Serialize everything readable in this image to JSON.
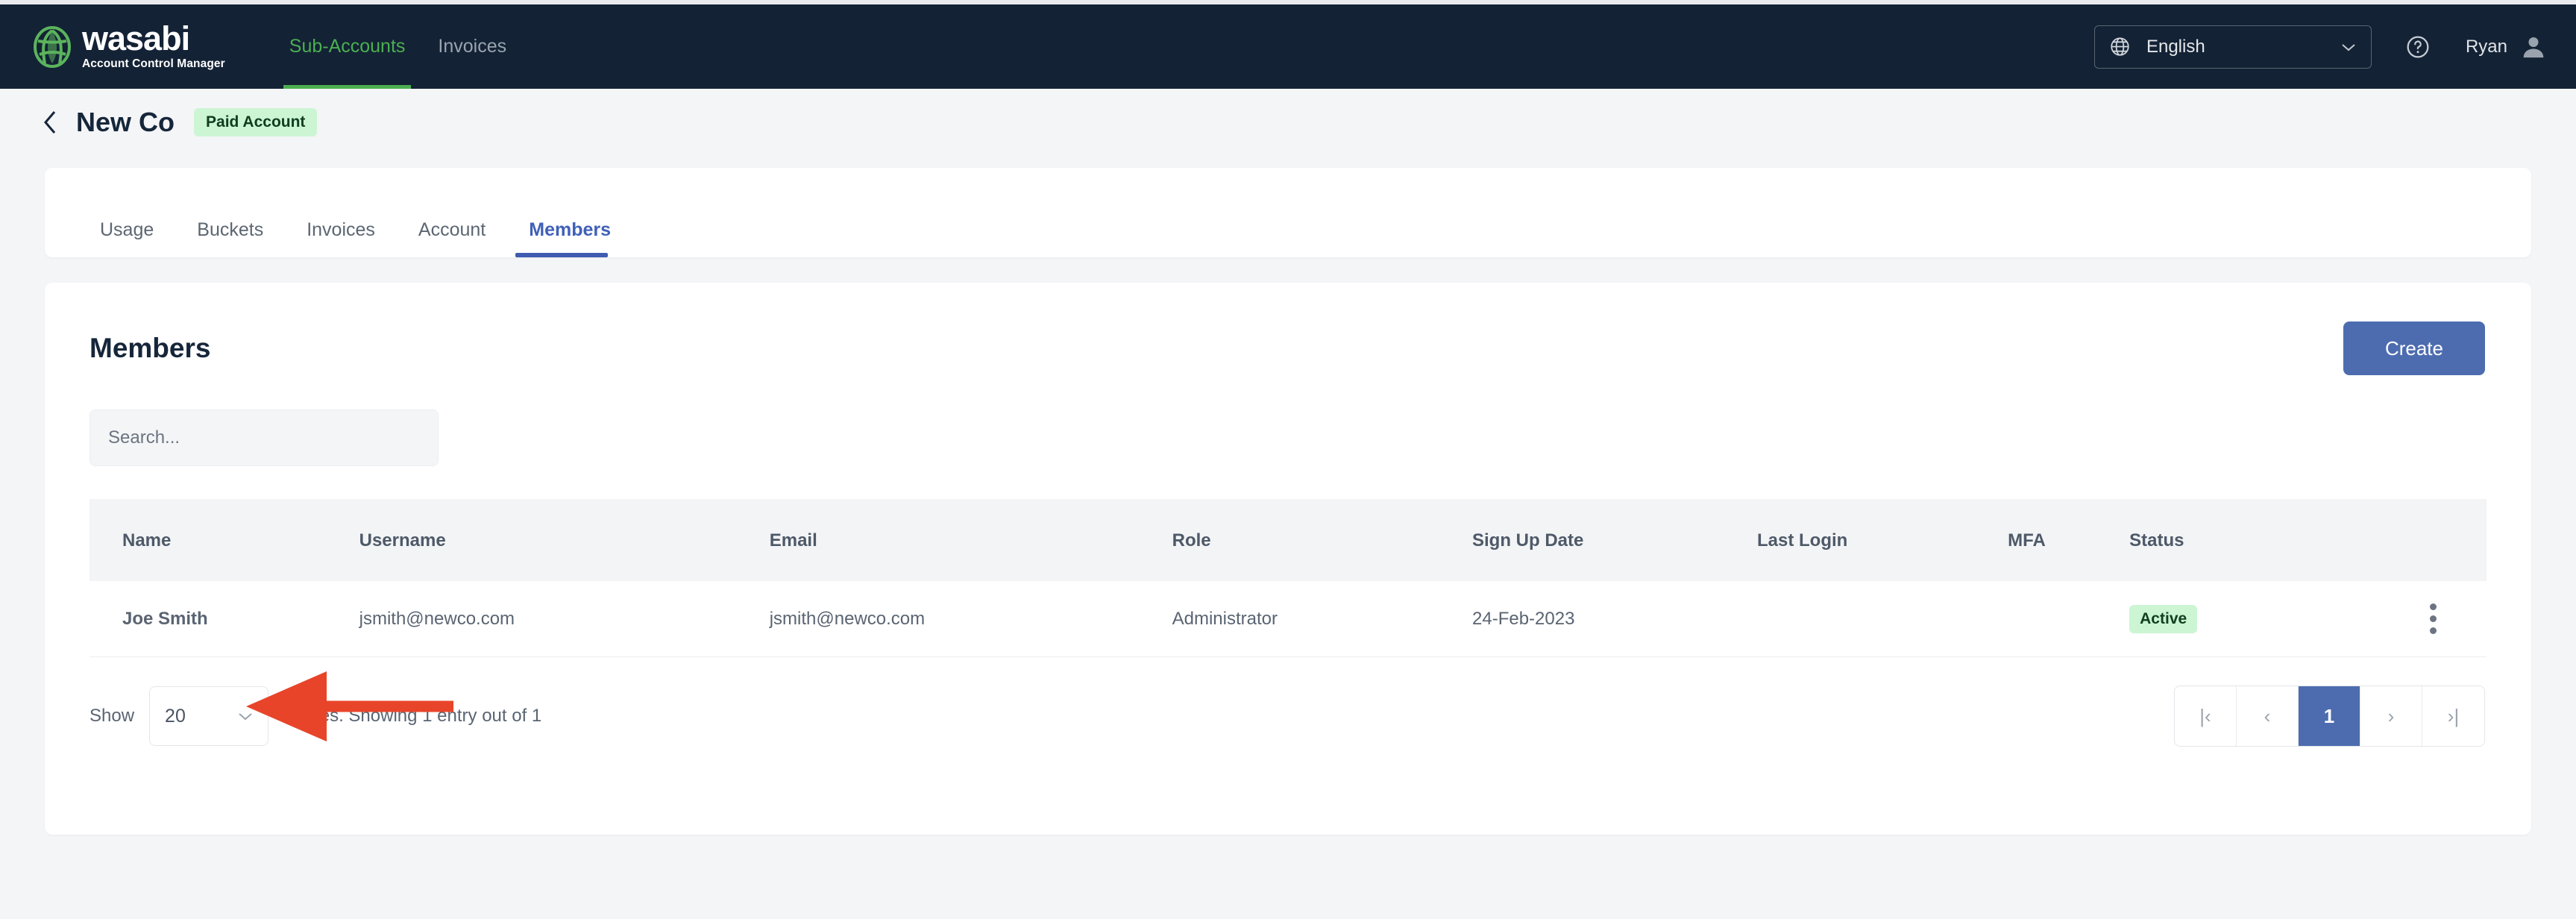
{
  "navbar": {
    "brand_word": "wasabi",
    "brand_sub": "Account Control Manager",
    "links": [
      {
        "label": "Sub-Accounts",
        "active": true
      },
      {
        "label": "Invoices",
        "active": false
      }
    ],
    "language": {
      "icon": "globe-icon",
      "value": "English"
    },
    "help_icon": "help-circle-icon",
    "user_name": "Ryan",
    "avatar_icon": "user-avatar-icon",
    "bg_color": "#132235",
    "accent_color": "#4caf50"
  },
  "page_head": {
    "back_icon": "chevron-left-icon",
    "title": "New Co",
    "badge": "Paid Account",
    "badge_bg": "#ccf5d4"
  },
  "tabs": [
    {
      "label": "Usage",
      "active": false
    },
    {
      "label": "Buckets",
      "active": false
    },
    {
      "label": "Invoices",
      "active": false
    },
    {
      "label": "Account",
      "active": false
    },
    {
      "label": "Members",
      "active": true
    }
  ],
  "members": {
    "title": "Members",
    "create_label": "Create",
    "create_bg": "#4d6cb0",
    "search_placeholder": "Search...",
    "search_value": "",
    "columns": [
      "Name",
      "Username",
      "Email",
      "Role",
      "Sign Up Date",
      "Last Login",
      "MFA",
      "Status"
    ],
    "rows": [
      {
        "name": "Joe Smith",
        "username": "jsmith@newco.com",
        "email": "jsmith@newco.com",
        "role": "Administrator",
        "signup": "24-Feb-2023",
        "last_login": "",
        "mfa": "",
        "status": "Active",
        "menu_icon": "kebab-menu-icon"
      }
    ],
    "footer": {
      "show_label": "Show",
      "page_size": "20",
      "entries_text": "entries. Showing 1 entry out of 1",
      "pagination": [
        {
          "label": "|‹",
          "name": "first-page",
          "active": false
        },
        {
          "label": "‹",
          "name": "prev-page",
          "active": false
        },
        {
          "label": "1",
          "name": "page-1",
          "active": true
        },
        {
          "label": "›",
          "name": "next-page",
          "active": false
        },
        {
          "label": "›|",
          "name": "last-page",
          "active": false
        }
      ]
    }
  },
  "annotation": {
    "type": "arrow",
    "color": "#e8442a",
    "direction": "left",
    "points_to": "Joe Smith"
  }
}
